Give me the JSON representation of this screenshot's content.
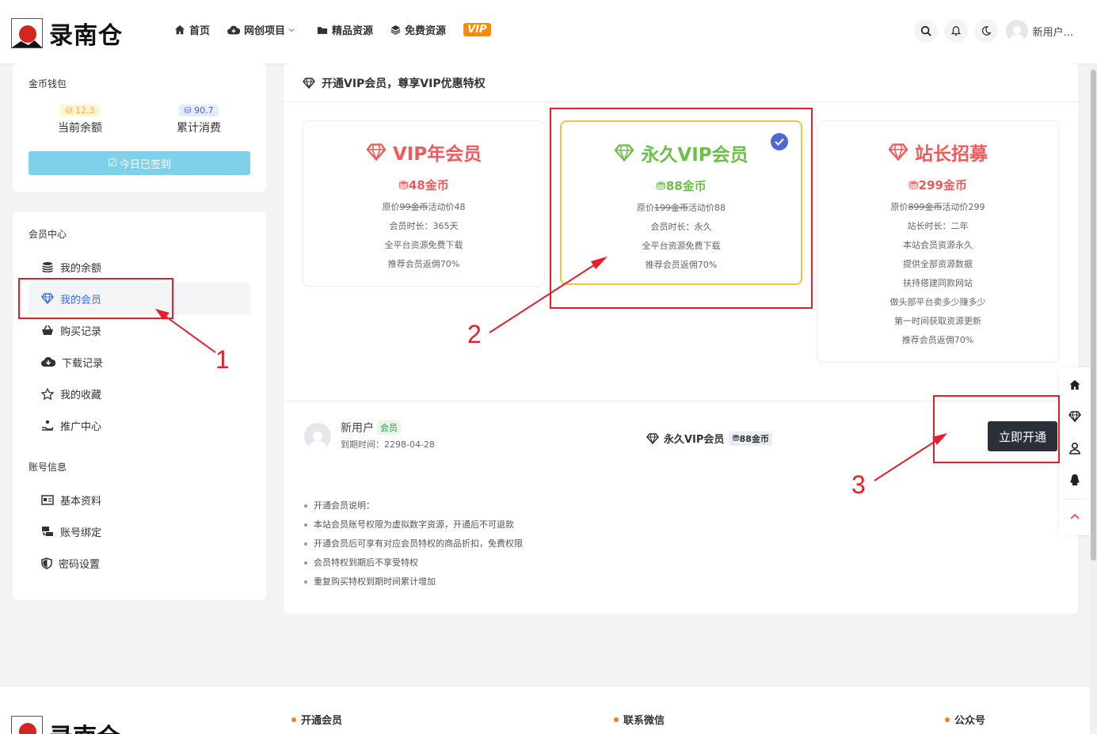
{
  "header": {
    "site_name": "录南仓",
    "nav": [
      {
        "label": "首页",
        "icon": "home-icon"
      },
      {
        "label": "网创项目",
        "icon": "cloud-icon"
      },
      {
        "label": "精品资源",
        "icon": "folder-icon"
      },
      {
        "label": "免费资源",
        "icon": "layers-icon"
      }
    ],
    "vip_label": "VIP",
    "username": "新用户..."
  },
  "wallet": {
    "title": "金币钱包",
    "balance_value": "12.3",
    "balance_label": "当前余额",
    "spent_value": "90.7",
    "spent_label": "累计消费",
    "signin_label": "今日已签到"
  },
  "member_center": {
    "title": "会员中心",
    "items": [
      {
        "label": "我的余额"
      },
      {
        "label": "我的会员"
      },
      {
        "label": "购买记录"
      },
      {
        "label": "下载记录"
      },
      {
        "label": "我的收藏"
      },
      {
        "label": "推广中心"
      }
    ],
    "account_title": "账号信息",
    "account_items": [
      {
        "label": "基本资料"
      },
      {
        "label": "账号绑定"
      },
      {
        "label": "密码设置"
      }
    ]
  },
  "main": {
    "title": "开通VIP会员，尊享VIP优惠特权",
    "plans": [
      {
        "name": "VIP年会员",
        "price": "48金币",
        "orig_prefix": "原价",
        "orig_price": "99金币",
        "promo": "活动价48",
        "lines": [
          "会员时长：365天",
          "全平台资源免费下载",
          "推荐会员返佣70%"
        ],
        "color": "#f05a5a"
      },
      {
        "name": "永久VIP会员",
        "price": "88金币",
        "orig_prefix": "原价",
        "orig_price": "199金币",
        "promo": "活动价88",
        "lines": [
          "会员时长：永久",
          "全平台资源免费下载",
          "推荐会员返佣70%"
        ],
        "color": "#6cc04a"
      },
      {
        "name": "站长招募",
        "price": "299金币",
        "orig_prefix": "原价",
        "orig_price": "899金币",
        "promo": "活动价299",
        "lines": [
          "站长时长：二年",
          "本站会员资源永久",
          "提供全部资源数据",
          "扶持搭建同款网站",
          "做头部平台卖多少赚多少",
          "第一时间获取资源更新",
          "推荐会员返佣70%"
        ],
        "color": "#f05a5a"
      }
    ],
    "buy": {
      "user": "新用户",
      "member_tag": "会员",
      "expire": "到期时间：2298-04-28",
      "selected_plan": "永久VIP会员",
      "selected_price": "88金币",
      "open_label": "立即开通"
    },
    "notes": [
      "开通会员说明：",
      "本站会员账号权限为虚拟数字资源，开通后不可退款",
      "开通会员后可享有对应会员特权的商品折扣，免费权限",
      "会员特权到期后不享受特权",
      "重复购买特权到期时间累计增加"
    ]
  },
  "footer": {
    "site_name": "录南仓",
    "columns": [
      "开通会员",
      "联系微信",
      "公众号"
    ]
  },
  "annotations": [
    "1",
    "2",
    "3"
  ]
}
